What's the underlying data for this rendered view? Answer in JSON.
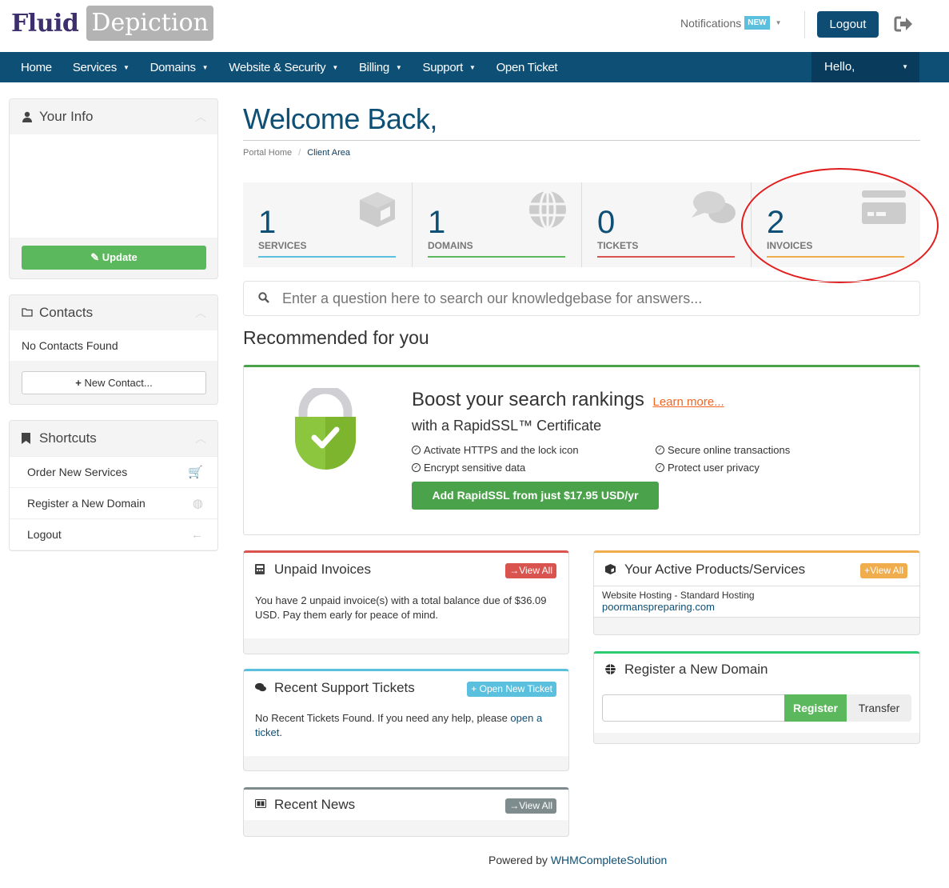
{
  "brand": {
    "part1": "Fluid",
    "part2": "Depiction"
  },
  "header": {
    "notifications_label": "Notifications",
    "notifications_badge": "NEW",
    "logout_label": "Logout"
  },
  "nav": {
    "items": [
      {
        "label": "Home",
        "dropdown": false
      },
      {
        "label": "Services",
        "dropdown": true
      },
      {
        "label": "Domains",
        "dropdown": true
      },
      {
        "label": "Website & Security",
        "dropdown": true
      },
      {
        "label": "Billing",
        "dropdown": true
      },
      {
        "label": "Support",
        "dropdown": true
      },
      {
        "label": "Open Ticket",
        "dropdown": false
      }
    ],
    "account_label": "Hello,"
  },
  "sidebar": {
    "your_info": {
      "title": "Your Info",
      "button": "Update"
    },
    "contacts": {
      "title": "Contacts",
      "empty": "No Contacts Found",
      "button": "New Contact..."
    },
    "shortcuts": {
      "title": "Shortcuts",
      "items": [
        {
          "label": "Order New Services",
          "icon": "cart-icon"
        },
        {
          "label": "Register a New Domain",
          "icon": "globe-icon"
        },
        {
          "label": "Logout",
          "icon": "arrow-left-icon"
        }
      ]
    }
  },
  "main": {
    "title": "Welcome Back,",
    "breadcrumb": [
      {
        "label": "Portal Home"
      },
      {
        "label": "Client Area"
      }
    ],
    "stats": [
      {
        "value": "1",
        "label": "SERVICES",
        "color": "#5bc0de",
        "icon": "cube-icon"
      },
      {
        "value": "1",
        "label": "DOMAINS",
        "color": "#5cb85c",
        "icon": "globe-icon"
      },
      {
        "value": "0",
        "label": "TICKETS",
        "color": "#d9534f",
        "icon": "comments-icon"
      },
      {
        "value": "2",
        "label": "INVOICES",
        "color": "#f0ad4e",
        "icon": "credit-card-icon"
      }
    ],
    "search_placeholder": "Enter a question here to search our knowledgebase for answers...",
    "recommended_title": "Recommended for you",
    "promo": {
      "heading": "Boost your search rankings",
      "learn_more": "Learn more...",
      "subheading": "with a RapidSSL™ Certificate",
      "features": [
        "Activate HTTPS and the lock icon",
        "Encrypt sensitive data",
        "Secure online transactions",
        "Protect user privacy"
      ],
      "cta": "Add RapidSSL from just $17.95 USD/yr"
    },
    "unpaid_invoices": {
      "title": "Unpaid Invoices",
      "button": "View All",
      "text": "You have 2 unpaid invoice(s) with a total balance due of $36.09 USD. Pay them early for peace of mind."
    },
    "active_products": {
      "title": "Your Active Products/Services",
      "button": "View All",
      "product": "Website Hosting - Standard Hosting",
      "domain": "poormanspreparing.com"
    },
    "support_tickets": {
      "title": "Recent Support Tickets",
      "button": "Open New Ticket",
      "text": "No Recent Tickets Found. If you need any help, please ",
      "link": "open a ticket",
      "after": "."
    },
    "register_domain": {
      "title": "Register a New Domain",
      "input_value": "",
      "register": "Register",
      "transfer": "Transfer"
    },
    "news": {
      "title": "Recent News",
      "button": "View All"
    }
  },
  "footer": {
    "prefix": "Powered by ",
    "link": "WHMCompleteSolution"
  }
}
